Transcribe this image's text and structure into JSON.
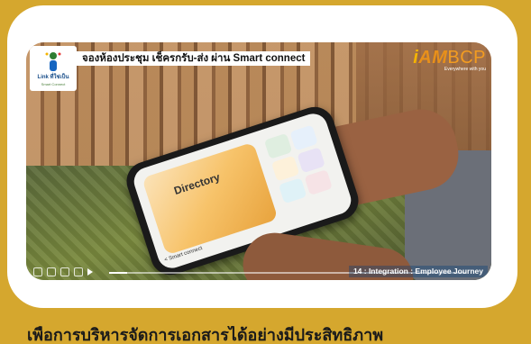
{
  "colors": {
    "background": "#d5a72e",
    "card": "#ffffff",
    "brand_orange": "#f39c21"
  },
  "video": {
    "headline": "จองห้องประชุม เช็ครกรับ-ส่ง ผ่าน Smart connect",
    "logo": {
      "text": "Link ที่ใช่เป็น",
      "sub": "Smart Connect"
    },
    "brand": {
      "i": "i",
      "am": "AM",
      "bcp": "BCP",
      "tagline": "Everywhere with you"
    },
    "caption": "14 : Integration : Employee Journey",
    "screen": {
      "title": "Directory",
      "back": "< Smart connect"
    },
    "progress": 0.05,
    "controls": [
      "expand-icon",
      "settings-icon",
      "volume-icon",
      "pause-icon",
      "play-icon"
    ]
  },
  "bottom_text": "เพื่อการบริหารจัดการเอกสารได้อย่างมีประสิทธิภาพ"
}
